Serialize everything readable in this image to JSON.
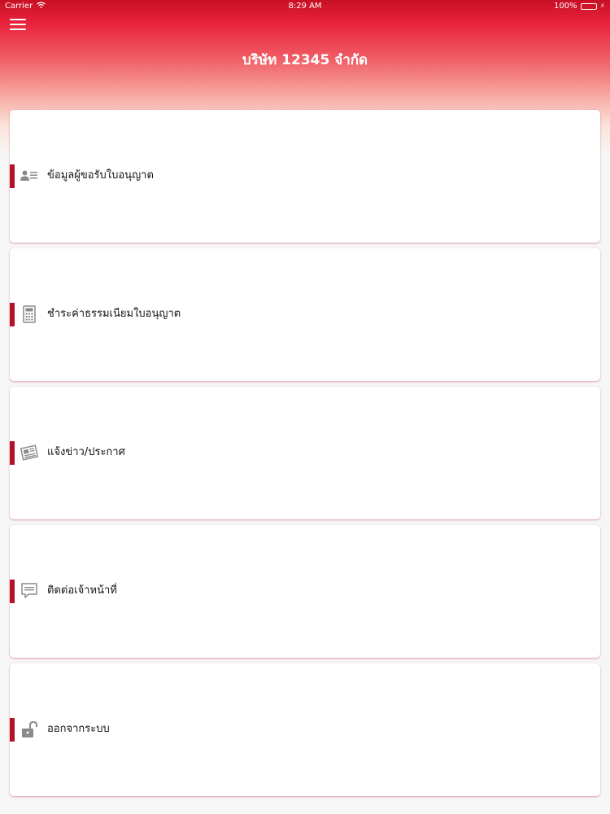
{
  "status_bar": {
    "carrier": "Carrier",
    "time": "8:29 AM",
    "battery": "100%",
    "battery_level": 1.0
  },
  "header": {
    "title": "บริษัท 12345 จำกัด"
  },
  "menu": {
    "items": [
      {
        "label": "ข้อมูลผู้ขอรับใบอนุญาต",
        "icon": "user-info-icon"
      },
      {
        "label": "ชำระค่าธรรมเนียมใบอนุญาต",
        "icon": "calculator-icon"
      },
      {
        "label": "แจ้งข่าว/ประกาศ",
        "icon": "newspaper-icon"
      },
      {
        "label": "ติดต่อเจ้าหน้าที่",
        "icon": "chat-icon"
      },
      {
        "label": "ออกจากระบบ",
        "icon": "unlock-icon"
      }
    ]
  },
  "colors": {
    "header_top": "#c70f24",
    "accent": "#b3122a",
    "icon": "#8a8a8a",
    "background": "#f6f6f6"
  }
}
